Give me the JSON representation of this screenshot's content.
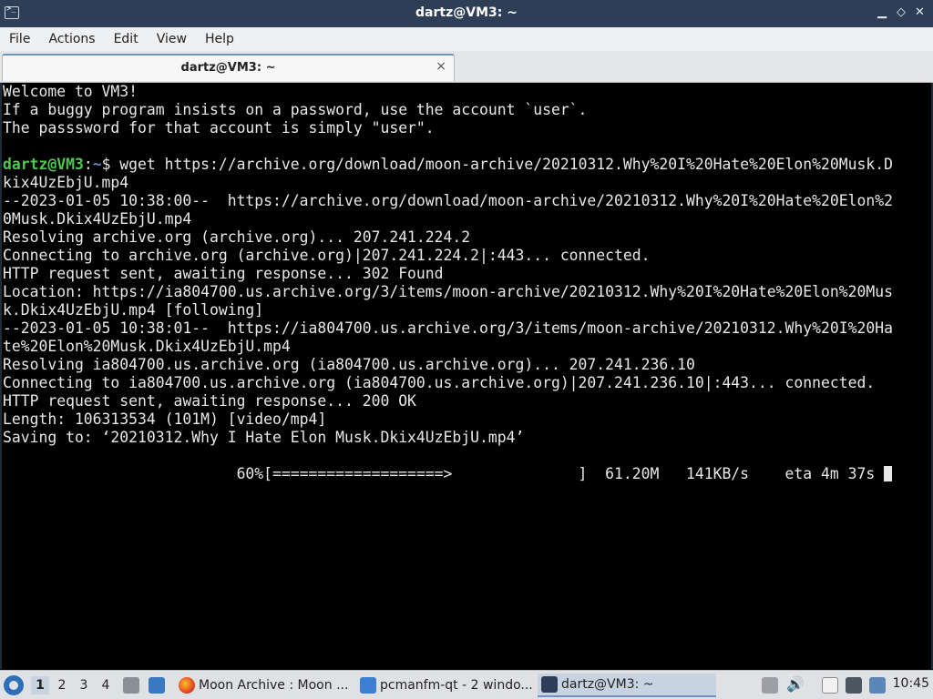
{
  "window": {
    "title": "dartz@VM3: ~",
    "controls": {
      "minimize": "▁",
      "maximize": "◇",
      "close": "✕"
    }
  },
  "menu": [
    "File",
    "Actions",
    "Edit",
    "View",
    "Help"
  ],
  "tab": {
    "label": "dartz@VM3: ~",
    "close": "×"
  },
  "terminal": {
    "welcome": [
      "Welcome to VM3!",
      "If a buggy program insists on a password, use the account `user`.",
      "The passsword for that account is simply \"user\"."
    ],
    "prompt": {
      "user_host": "dartz@VM3",
      "sep": ":",
      "path": "~",
      "symbol": "$"
    },
    "command": " wget https://archive.org/download/moon-archive/20210312.Why%20I%20Hate%20Elon%20Musk.D",
    "output": [
      "kix4UzEbjU.mp4",
      "--2023-01-05 10:38:00--  https://archive.org/download/moon-archive/20210312.Why%20I%20Hate%20Elon%2",
      "0Musk.Dkix4UzEbjU.mp4",
      "Resolving archive.org (archive.org)... 207.241.224.2",
      "Connecting to archive.org (archive.org)|207.241.224.2|:443... connected.",
      "HTTP request sent, awaiting response... 302 Found",
      "Location: https://ia804700.us.archive.org/3/items/moon-archive/20210312.Why%20I%20Hate%20Elon%20Mus",
      "k.Dkix4UzEbjU.mp4 [following]",
      "--2023-01-05 10:38:01--  https://ia804700.us.archive.org/3/items/moon-archive/20210312.Why%20I%20Ha",
      "te%20Elon%20Musk.Dkix4UzEbjU.mp4",
      "Resolving ia804700.us.archive.org (ia804700.us.archive.org)... 207.241.236.10",
      "Connecting to ia804700.us.archive.org (ia804700.us.archive.org)|207.241.236.10|:443... connected.",
      "HTTP request sent, awaiting response... 200 OK",
      "Length: 106313534 (101M) [video/mp4]",
      "Saving to: ‘20210312.Why I Hate Elon Musk.Dkix4UzEbjU.mp4’",
      ""
    ],
    "progress": "                          60%[===================>              ]  61.20M   141KB/s    eta 4m 37s "
  },
  "taskbar": {
    "workspaces": [
      "1",
      "2",
      "3",
      "4"
    ],
    "active_workspace": "1",
    "tasks": [
      {
        "label": "Moon Archive : Moon ...",
        "icon": "firefox-icon"
      },
      {
        "label": "pcmanfm-qt - 2 windo...",
        "icon": "folder-icon"
      },
      {
        "label": "dartz@VM3: ~",
        "icon": "terminal-icon"
      }
    ],
    "clock": "10:45"
  }
}
